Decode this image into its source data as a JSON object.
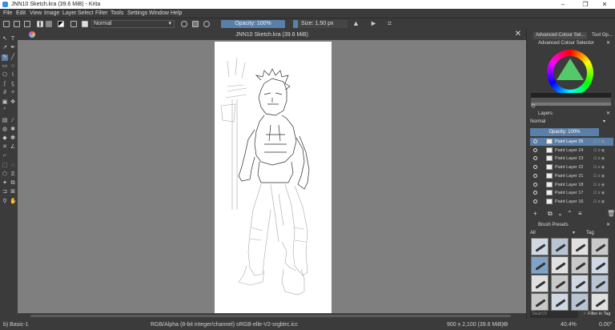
{
  "window": {
    "title": "JNN10 Sketch.kra (39.6 MiB) - Krita",
    "controls": [
      "–",
      "❐",
      "✕"
    ]
  },
  "menu": [
    "File",
    "Edit",
    "View",
    "Image",
    "Layer",
    "Select",
    "Filter",
    "Tools",
    "Settings",
    "Window",
    "Help"
  ],
  "toolbar": {
    "blend_mode": "Normal",
    "opacity": "Opacity: 100%",
    "size": "Size: 1.50 px"
  },
  "document": {
    "tab_title": "JNN10 Sketch.kra (39.6 MiB)"
  },
  "dock": {
    "tabs": [
      "Advanced Colour Sel...",
      "Tool Op..."
    ],
    "color_selector_title": "Advanced Colour Selector",
    "layers_title": "Layers",
    "layer_blend": "Normal",
    "layer_opacity": "Opacity: 100%",
    "layers": [
      {
        "name": "Paint Layer 25",
        "selected": true
      },
      {
        "name": "Paint Layer 24",
        "selected": false
      },
      {
        "name": "Paint Layer 23",
        "selected": false
      },
      {
        "name": "Paint Layer 22",
        "selected": false
      },
      {
        "name": "Paint Layer 21",
        "selected": false
      },
      {
        "name": "Paint Layer 18",
        "selected": false
      },
      {
        "name": "Paint Layer 17",
        "selected": false
      },
      {
        "name": "Paint Layer 16",
        "selected": false
      }
    ],
    "brush_presets_title": "Brush Presets",
    "brush_filter": "All",
    "brush_tag": "Tag",
    "search_placeholder": "Search",
    "filter_in_tag": "Filter in Tag"
  },
  "status": {
    "brush": "b) Basic-1",
    "color_model": "RGB/Alpha (8-bit integer/channel)  sRGB-elle-V2-srgbtrc.icc",
    "dimensions": "900 x 2,100 (39.6 MiB)",
    "zoom": "40.4%",
    "rotation": "0.00°"
  },
  "colors": {
    "accent": "#5a7fa8",
    "panel": "#3b3b3b",
    "canvas_bg": "#7f7f7f"
  }
}
